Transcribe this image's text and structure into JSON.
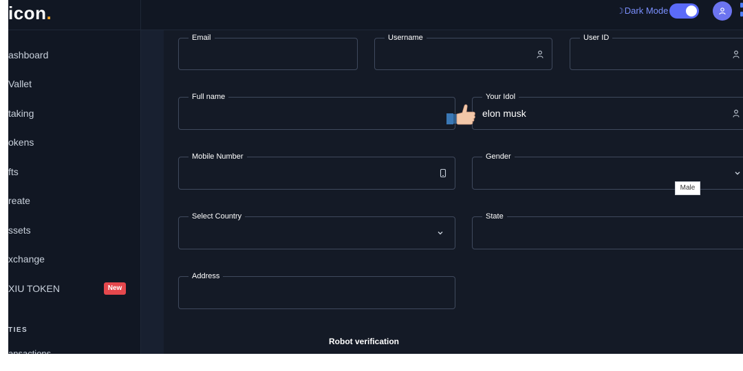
{
  "header": {
    "brand_text": "icon",
    "brand_dot": ".",
    "dark_mode_label": "Dark Mode",
    "dark_mode_on": true
  },
  "sidebar": {
    "items": [
      {
        "label": "ashboard"
      },
      {
        "label": "Vallet"
      },
      {
        "label": "taking"
      },
      {
        "label": "okens"
      },
      {
        "label": "fts"
      },
      {
        "label": "reate"
      },
      {
        "label": "ssets"
      },
      {
        "label": "xchange"
      },
      {
        "label": "XIU TOKEN",
        "badge": "New"
      }
    ],
    "section_title": "TIES",
    "cut_item": "ansactions"
  },
  "form": {
    "email": {
      "label": "Email",
      "value": ""
    },
    "username": {
      "label": "Username",
      "value": ""
    },
    "user_id": {
      "label": "User ID",
      "value": ""
    },
    "full_name": {
      "label": "Full name",
      "value": ""
    },
    "idol": {
      "label": "Your Idol",
      "value": "elon musk"
    },
    "mobile": {
      "label": "Mobile Number",
      "value": ""
    },
    "gender": {
      "label": "Gender",
      "value": ""
    },
    "country": {
      "label": "Select Country",
      "value": ""
    },
    "state": {
      "label": "State",
      "value": ""
    },
    "address": {
      "label": "Address",
      "value": ""
    },
    "robot_label": "Robot verification"
  },
  "tooltip": {
    "text": "Male"
  },
  "colors": {
    "background": "#141a26",
    "sidebar": "#111723",
    "accent": "#5b6bf8",
    "brand_dot": "#f5a524",
    "badge": "#e5484d"
  },
  "icons": [
    "moon-icon",
    "user-icon",
    "phone-icon",
    "chevron-down-icon",
    "thumbs-up-icon"
  ]
}
